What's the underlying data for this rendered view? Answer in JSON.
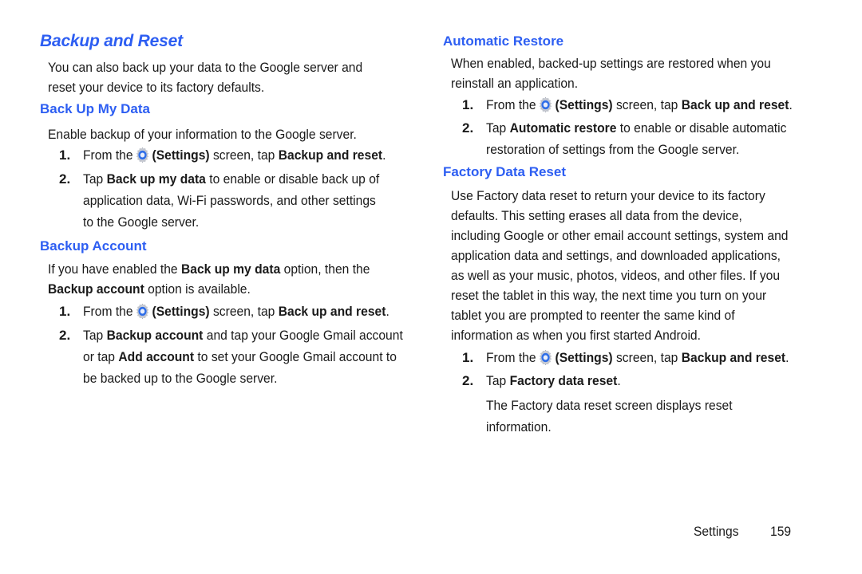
{
  "page": {
    "title": "Backup and Reset",
    "intro": [
      "You can also back up your data to the Google server and",
      "reset your device to its factory defaults."
    ],
    "footer": {
      "section": "Settings",
      "page_number": "159"
    },
    "accent_color": "#2d5ef2"
  },
  "back_up_my_data": {
    "heading": "Back Up My Data",
    "intro": "Enable backup of your information to the Google server.",
    "step1": {
      "num": "1.",
      "pre": "From the",
      "settings": "(Settings)",
      "mid": "screen, tap",
      "bold": "Backup and reset",
      "post": "."
    },
    "step2": {
      "num": "2.",
      "line1_pre": "Tap",
      "line1_bold": "Back up my data",
      "line1_post": "to enable or disable back up of",
      "line2": "application data, Wi-Fi passwords, and other settings",
      "line3": "to the Google server."
    }
  },
  "backup_account": {
    "heading": "Backup Account",
    "intro_line1_pre": "If you have enabled the",
    "intro_line1_bold": "Back up my data",
    "intro_line1_post": "option, then the",
    "intro_line2_bold": "Backup account",
    "intro_line2_post": "option is available.",
    "step1": {
      "num": "1.",
      "pre": "From the",
      "settings": "(Settings)",
      "mid": "screen, tap",
      "bold": "Back up and reset",
      "post": "."
    },
    "step2": {
      "num": "2.",
      "line1_pre": "Tap",
      "line1_bold": "Backup account",
      "line1_post": "and tap your Google Gmail account",
      "line2_pre": "or tap",
      "line2_bold": "Add account",
      "line2_post": "to set your Google Gmail account to",
      "line3": "be backed up to the Google server."
    }
  },
  "automatic_restore": {
    "heading": "Automatic Restore",
    "intro": [
      "When enabled, backed-up settings are restored when you",
      "reinstall an application."
    ],
    "step1": {
      "num": "1.",
      "pre": "From the",
      "settings": "(Settings)",
      "mid": "screen, tap",
      "bold": "Back up and reset",
      "post": "."
    },
    "step2": {
      "num": "2.",
      "line1_pre": "Tap",
      "line1_bold": "Automatic restore",
      "line1_post": "to enable or disable automatic",
      "line2": "restoration of settings from the Google server."
    }
  },
  "factory_data_reset": {
    "heading": "Factory Data Reset",
    "intro": [
      "Use Factory data reset to return your device to its factory",
      "defaults. This setting erases all data from the device,",
      "including Google or other email account settings, system and",
      "application data and settings, and downloaded applications,",
      "as well as your music, photos, videos, and other files. If you",
      "reset the tablet in this way, the next time you turn on your",
      "tablet you are prompted to reenter the same kind of",
      "information as when you first started Android."
    ],
    "step1": {
      "num": "1.",
      "pre": "From the",
      "settings": "(Settings)",
      "mid": "screen, tap",
      "bold": "Backup and reset",
      "post": "."
    },
    "step2": {
      "num": "2.",
      "pre": "Tap",
      "bold": "Factory data reset",
      "post": "."
    },
    "result": [
      "The Factory data reset screen displays reset",
      "information."
    ]
  }
}
